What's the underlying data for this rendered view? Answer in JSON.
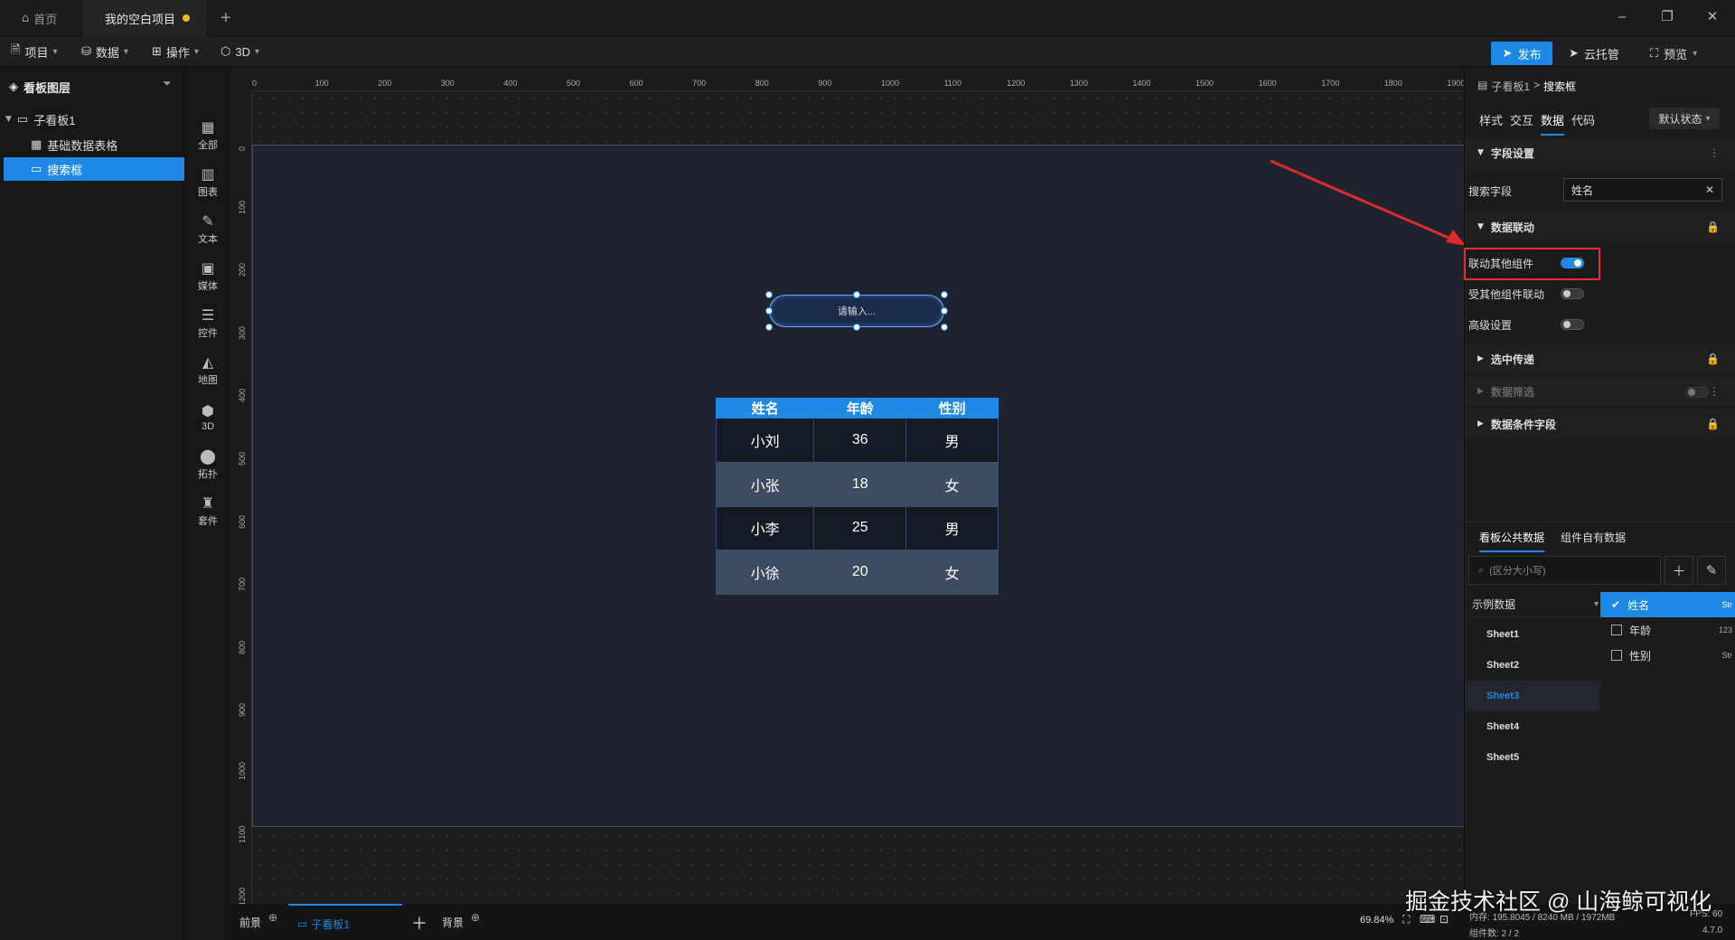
{
  "tabs": {
    "home": "首页",
    "project": "我的空白项目",
    "add": "+"
  },
  "menu": {
    "project": "项目",
    "data": "数据",
    "operate": "操作",
    "three_d": "3D"
  },
  "actions": {
    "publish": "发布",
    "cloud": "云托管",
    "preview": "预览"
  },
  "layers": {
    "title": "看板图层",
    "board": "子看板1",
    "table": "基础数据表格",
    "search": "搜索框"
  },
  "toolbox": [
    "全部",
    "图表",
    "文本",
    "媒体",
    "控件",
    "地图",
    "3D",
    "拓扑",
    "套件"
  ],
  "ruler": {
    "top": [
      "0",
      "100",
      "200",
      "300",
      "400",
      "500",
      "600",
      "700",
      "800",
      "900",
      "1000",
      "1100",
      "1200",
      "1300",
      "1400",
      "1500",
      "1600",
      "1700",
      "1800",
      "1900"
    ],
    "left": [
      "0",
      "100",
      "200",
      "300",
      "400",
      "500",
      "600",
      "700",
      "800",
      "900",
      "1000",
      "1100",
      "1200"
    ]
  },
  "canvas": {
    "search_placeholder": "请输入...",
    "table_headers": [
      "姓名",
      "年龄",
      "性别"
    ],
    "table_rows": [
      [
        "小刘",
        "36",
        "男"
      ],
      [
        "小张",
        "18",
        "女"
      ],
      [
        "小李",
        "25",
        "男"
      ],
      [
        "小徐",
        "20",
        "女"
      ]
    ]
  },
  "right": {
    "crumb_board": "子看板1",
    "crumb_sep": ">",
    "crumb_item": "搜索框",
    "tabs": [
      "样式",
      "交互",
      "数据",
      "代码"
    ],
    "state": "默认状态",
    "field_section": "字段设置",
    "search_field_label": "搜索字段",
    "search_field_value": "姓名",
    "link_section": "数据联动",
    "link_other": "联动其他组件",
    "linked_by_other": "受其他组件联动",
    "advanced": "高级设置",
    "select_pass": "选中传递",
    "data_filter": "数据筛选",
    "data_cond": "数据条件字段",
    "bp_tab_public": "看板公共数据",
    "bp_tab_own": "组件自有数据",
    "bp_search_placeholder": "(区分大小写)",
    "dataset": "示例数据",
    "sheets": [
      "Sheet1",
      "Sheet2",
      "Sheet3",
      "Sheet4",
      "Sheet5"
    ],
    "fields": [
      {
        "name": "姓名",
        "type": "Str",
        "checked": true
      },
      {
        "name": "年龄",
        "type": "123",
        "checked": false
      },
      {
        "name": "性别",
        "type": "Str",
        "checked": false
      }
    ]
  },
  "bottom": {
    "foreground": "前景",
    "board_tab": "子看板1",
    "background": "背景",
    "zoom": "69.84%"
  },
  "status": {
    "memory": "内存: 195.8045 / 8240 MB / 1972MB",
    "fps": "FPS: 60",
    "count": "组件数: 2 / 2",
    "version": "4.7.0"
  },
  "watermark": "掘金技术社区 @ 山海鲸可视化"
}
